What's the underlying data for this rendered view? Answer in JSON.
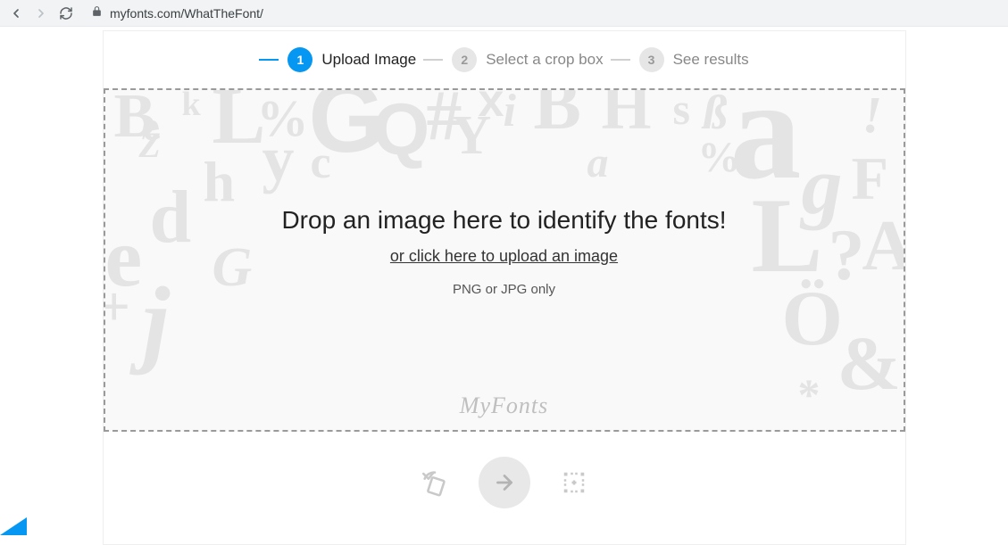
{
  "browser": {
    "url": "myfonts.com/WhatTheFont/"
  },
  "steps": [
    {
      "num": "1",
      "label": "Upload Image",
      "active": true
    },
    {
      "num": "2",
      "label": "Select a crop box",
      "active": false
    },
    {
      "num": "3",
      "label": "See results",
      "active": false
    }
  ],
  "dropzone": {
    "title": "Drop an image here to identify the fonts!",
    "link": "or click here to upload an image",
    "sub": "PNG or JPG only",
    "brand": "MyFonts"
  }
}
